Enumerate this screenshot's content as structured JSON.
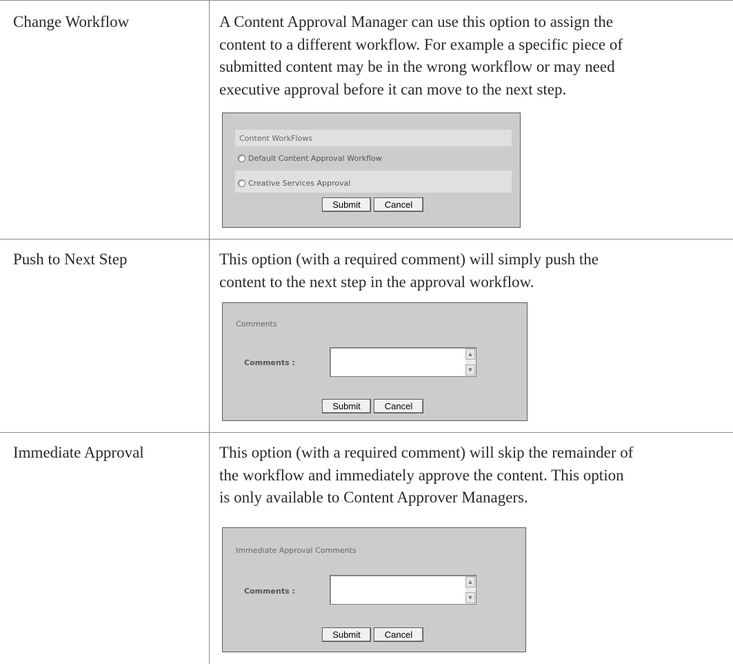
{
  "rows": [
    {
      "option": "Change Workflow",
      "description_lines": [
        "A Content Approval Manager can use this option to assign the",
        "content to a different workflow. For example a specific piece of",
        "submitted content may be in the wrong workflow or may need",
        "executive approval before it can move to the next step."
      ],
      "panel": {
        "title": "Content WorkFlows",
        "radio_options": [
          "Default Content Approval Workflow",
          "Creative Services Approval"
        ],
        "submit_label": "Submit",
        "cancel_label": "Cancel"
      }
    },
    {
      "option": "Push to Next Step",
      "description_lines": [
        "This option (with a required comment) will simply push the",
        "content to the next step in the approval workflow."
      ],
      "panel": {
        "title": "Comments",
        "comments_label": "Comments :",
        "submit_label": "Submit",
        "cancel_label": "Cancel"
      }
    },
    {
      "option": "Immediate Approval",
      "description_lines": [
        "This option (with a required comment) will skip the remainder of",
        "the workflow and immediately approve the content. This option",
        "is only available to Content Approver Managers."
      ],
      "panel": {
        "title": "Immediate Approval Comments",
        "comments_label": "Comments :",
        "submit_label": "Submit",
        "cancel_label": "Cancel"
      }
    }
  ],
  "icons": {
    "scroll_up": "scroll-up-arrow-icon",
    "scroll_down": "scroll-down-arrow-icon",
    "radio": "radio-button-icon"
  }
}
